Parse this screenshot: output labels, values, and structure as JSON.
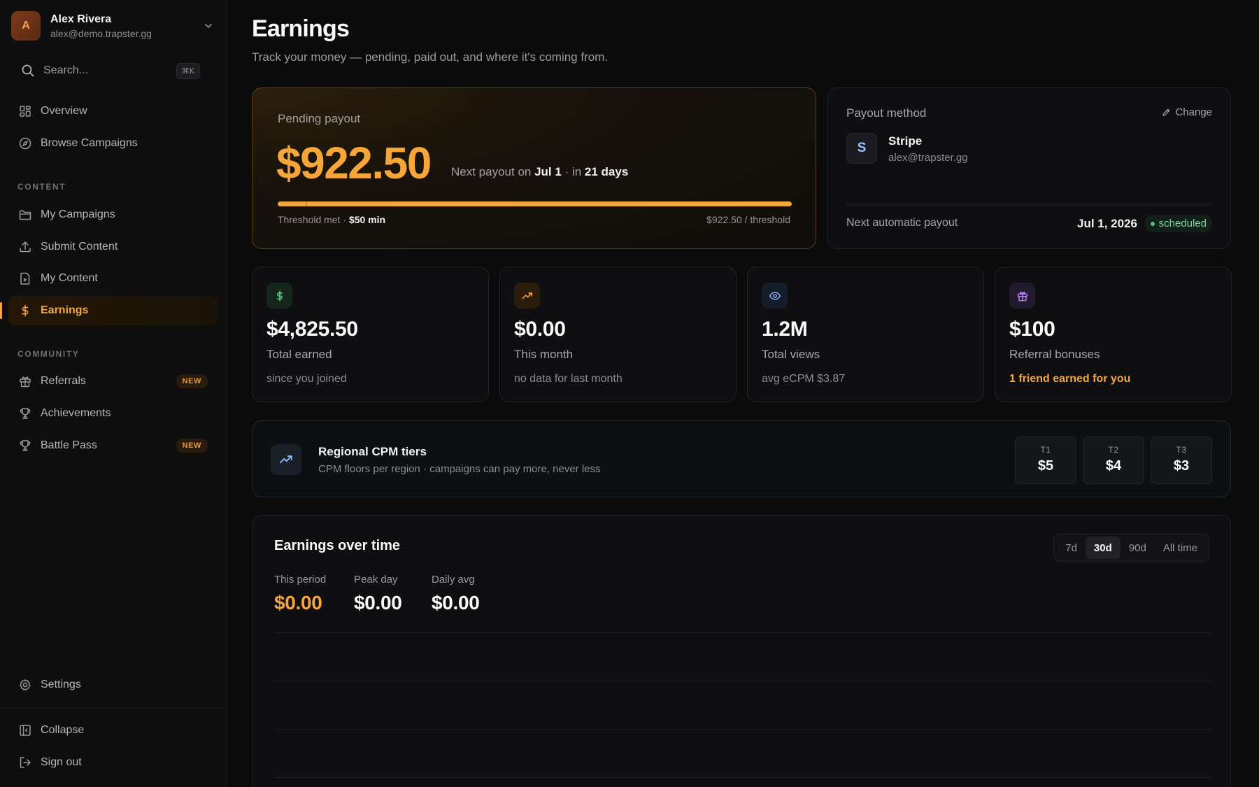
{
  "user": {
    "initial": "A",
    "name": "Alex Rivera",
    "email": "alex@demo.trapster.gg"
  },
  "search": {
    "label": "Search...",
    "shortcut": "⌘K"
  },
  "nav": {
    "overview": "Overview",
    "browse": "Browse Campaigns",
    "content_section": "CONTENT",
    "my_campaigns": "My Campaigns",
    "submit_content": "Submit Content",
    "my_content": "My Content",
    "earnings": "Earnings",
    "community_section": "COMMUNITY",
    "referrals": "Referrals",
    "achievements": "Achievements",
    "battle_pass": "Battle Pass",
    "new_badge": "NEW",
    "settings": "Settings",
    "collapse": "Collapse",
    "sign_out": "Sign out"
  },
  "page": {
    "title": "Earnings",
    "subtitle": "Track your money — pending, paid out, and where it's coming from."
  },
  "pending": {
    "label": "Pending payout",
    "amount": "$922.50",
    "next_prefix": "Next payout on ",
    "next_date": "Jul 1",
    "next_mid": " · in ",
    "next_days": "21 days",
    "progress": 1.0,
    "threshold_prefix": "Threshold met · ",
    "threshold_min": "$50 min",
    "threshold_right": "$922.50 / threshold"
  },
  "payout": {
    "title": "Payout method",
    "change": "Change",
    "provider_initial": "S",
    "provider": "Stripe",
    "email": "alex@trapster.gg",
    "auto_label": "Next automatic payout",
    "auto_date": "Jul 1, 2026",
    "status": "scheduled"
  },
  "stats": [
    {
      "value": "$4,825.50",
      "label": "Total earned",
      "sub": "since you joined",
      "icon": "dollar-icon",
      "color": "#5fcf8a"
    },
    {
      "value": "$0.00",
      "label": "This month",
      "sub": "no data for last month",
      "icon": "trending-up-icon",
      "color": "#f3a640"
    },
    {
      "value": "1.2M",
      "label": "Total views",
      "sub": "avg eCPM $3.87",
      "icon": "eye-icon",
      "color": "#8fb6ff"
    },
    {
      "value": "$100",
      "label": "Referral bonuses",
      "sub": "1 friend earned for you",
      "icon": "gift-icon",
      "color": "#c08cff"
    }
  ],
  "cpm": {
    "title": "Regional CPM tiers",
    "subtitle": "CPM floors per region · campaigns can pay more, never less",
    "tiers": [
      {
        "name": "T1",
        "value": "$5"
      },
      {
        "name": "T2",
        "value": "$4"
      },
      {
        "name": "T3",
        "value": "$3"
      }
    ]
  },
  "chart": {
    "title": "Earnings over time",
    "ranges": [
      "7d",
      "30d",
      "90d",
      "All time"
    ],
    "selected_range": "30d",
    "metrics": [
      {
        "label": "This period",
        "value": "$0.00"
      },
      {
        "label": "Peak day",
        "value": "$0.00"
      },
      {
        "label": "Daily avg",
        "value": "$0.00"
      }
    ]
  }
}
